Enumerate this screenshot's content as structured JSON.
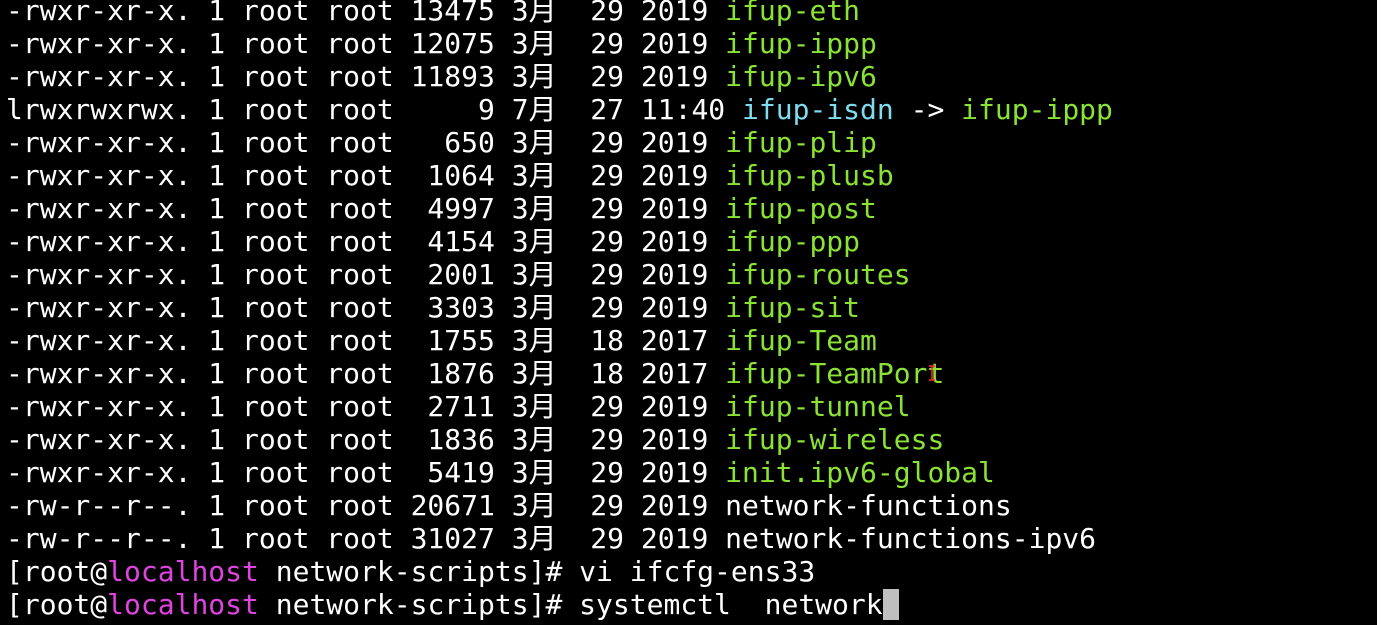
{
  "colors": {
    "background": "#000000",
    "text": "#ffffff",
    "executable": "#8ae234",
    "symlink": "#7fdcf0",
    "hostname": "#e043e0",
    "cursor": "#bfbfbf"
  },
  "listing": [
    {
      "meta": "-rwxr-xr-x. 1 root root 13475 3月  29 2019 ",
      "name": "ifup-eth"
    },
    {
      "meta": "-rwxr-xr-x. 1 root root 12075 3月  29 2019 ",
      "name": "ifup-ippp"
    },
    {
      "meta": "-rwxr-xr-x. 1 root root 11893 3月  29 2019 ",
      "name": "ifup-ipv6"
    },
    {
      "meta": "lrwxrwxrwx. 1 root root     9 7月  27 11:40 ",
      "name": "ifup-isdn",
      "arrow": " -> ",
      "target": "ifup-ippp"
    },
    {
      "meta": "-rwxr-xr-x. 1 root root   650 3月  29 2019 ",
      "name": "ifup-plip"
    },
    {
      "meta": "-rwxr-xr-x. 1 root root  1064 3月  29 2019 ",
      "name": "ifup-plusb"
    },
    {
      "meta": "-rwxr-xr-x. 1 root root  4997 3月  29 2019 ",
      "name": "ifup-post"
    },
    {
      "meta": "-rwxr-xr-x. 1 root root  4154 3月  29 2019 ",
      "name": "ifup-ppp"
    },
    {
      "meta": "-rwxr-xr-x. 1 root root  2001 3月  29 2019 ",
      "name": "ifup-routes"
    },
    {
      "meta": "-rwxr-xr-x. 1 root root  3303 3月  29 2019 ",
      "name": "ifup-sit"
    },
    {
      "meta": "-rwxr-xr-x. 1 root root  1755 3月  18 2017 ",
      "name": "ifup-Team"
    },
    {
      "meta": "-rwxr-xr-x. 1 root root  1876 3月  18 2017 ",
      "name": "ifup-TeamPort"
    },
    {
      "meta": "-rwxr-xr-x. 1 root root  2711 3月  29 2019 ",
      "name": "ifup-tunnel"
    },
    {
      "meta": "-rwxr-xr-x. 1 root root  1836 3月  29 2019 ",
      "name": "ifup-wireless"
    },
    {
      "meta": "-rwxr-xr-x. 1 root root  5419 3月  29 2019 ",
      "name": "init.ipv6-global"
    },
    {
      "meta": "-rw-r--r--. 1 root root 20671 3月  29 2019 ",
      "name": "network-functions"
    },
    {
      "meta": "-rw-r--r--. 1 root root 31027 3月  29 2019 ",
      "name": "network-functions-ipv6"
    }
  ],
  "prompt": {
    "open": "[root@",
    "host": "localhost",
    "path": " network-scripts]# "
  },
  "commands": [
    {
      "text": "vi ifcfg-ens33"
    },
    {
      "text": "systemctl  network"
    }
  ]
}
